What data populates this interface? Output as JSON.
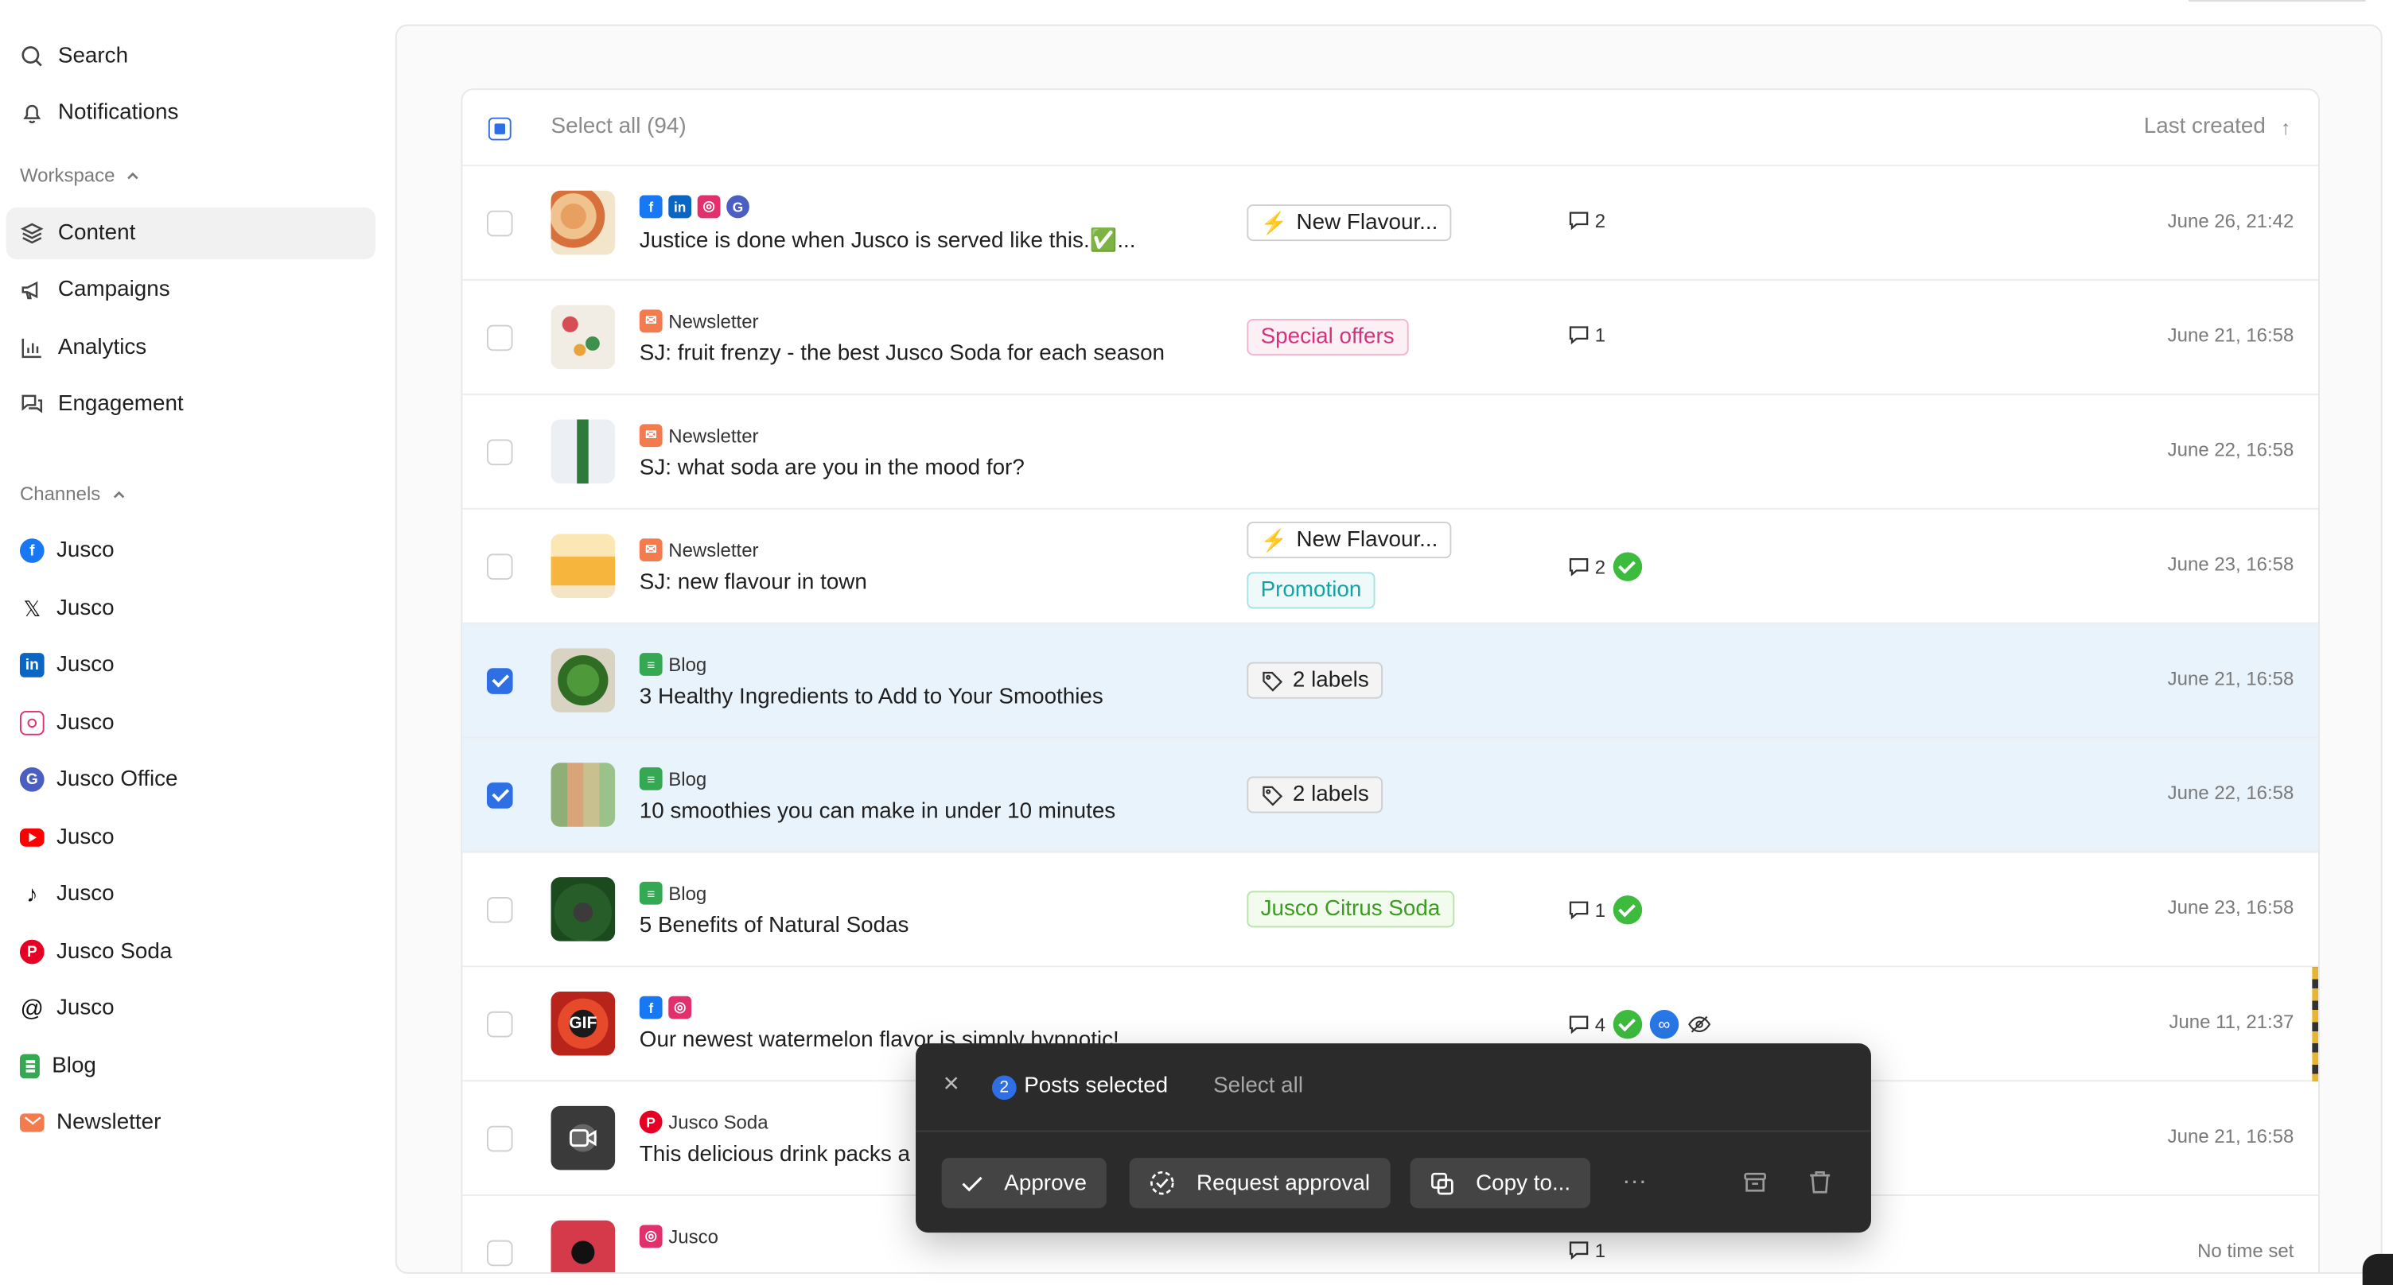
{
  "sidebar": {
    "search": "Search",
    "notifications": "Notifications",
    "workspace_heading": "Workspace",
    "workspace_items": [
      "Content",
      "Campaigns",
      "Analytics",
      "Engagement"
    ],
    "channels_heading": "Channels",
    "channels": [
      {
        "label": "Jusco",
        "icon": "facebook-icon",
        "color": "#1877f2"
      },
      {
        "label": "Jusco",
        "icon": "x-icon",
        "color": "#111111"
      },
      {
        "label": "Jusco",
        "icon": "linkedin-icon",
        "color": "#0a66c2"
      },
      {
        "label": "Jusco",
        "icon": "instagram-icon",
        "color": "#e1306c"
      },
      {
        "label": "Jusco Office",
        "icon": "google-business-icon",
        "color": "#4285f4"
      },
      {
        "label": "Jusco",
        "icon": "youtube-icon",
        "color": "#ff0000"
      },
      {
        "label": "Jusco",
        "icon": "tiktok-icon",
        "color": "#111111"
      },
      {
        "label": "Jusco Soda",
        "icon": "pinterest-icon",
        "color": "#e60023"
      },
      {
        "label": "Jusco",
        "icon": "threads-icon",
        "color": "#111111"
      },
      {
        "label": "Blog",
        "icon": "blog-icon",
        "color": "#34a853"
      },
      {
        "label": "Newsletter",
        "icon": "newsletter-icon",
        "color": "#f47b4d"
      }
    ]
  },
  "table": {
    "select_all": "Select all (94)",
    "sort_label": "Last created",
    "sort_arrow": "↑",
    "rows": [
      {
        "channel": "",
        "title": "Justice is done when Jusco is served like this.✅...",
        "tags": [
          "New Flavour..."
        ],
        "comments": "2",
        "date": "June 26, 21:42"
      },
      {
        "channel": "Newsletter",
        "title": "SJ: fruit frenzy - the best Jusco Soda for each season",
        "tags": [
          "Special offers"
        ],
        "comments": "1",
        "date": "June 21, 16:58"
      },
      {
        "channel": "Newsletter",
        "title": "SJ: what soda are you in the mood for?",
        "tags": [],
        "comments": "",
        "date": "June 22, 16:58"
      },
      {
        "channel": "Newsletter",
        "title": "SJ: new flavour in town",
        "tags": [
          "New Flavour...",
          "Promotion"
        ],
        "comments": "2",
        "date": "June 23, 16:58"
      },
      {
        "channel": "Blog",
        "title": "3 Healthy Ingredients to Add to Your Smoothies",
        "tags": [
          "2 labels"
        ],
        "comments": "",
        "date": "June 21, 16:58",
        "selected": true
      },
      {
        "channel": "Blog",
        "title": "10 smoothies you can make in under 10 minutes",
        "tags": [
          "2 labels"
        ],
        "comments": "",
        "date": "June 22, 16:58",
        "selected": true
      },
      {
        "channel": "Blog",
        "title": "5 Benefits of Natural Sodas",
        "tags": [
          "Jusco Citrus Soda"
        ],
        "comments": "1",
        "date": "June 23, 16:58"
      },
      {
        "channel": "",
        "title": "Our newest watermelon flavor is simply hypnotic!",
        "tags": [],
        "comments": "4",
        "date": "June 11, 21:37"
      },
      {
        "channel": "Jusco Soda",
        "title": "This delicious drink packs a",
        "tags": [],
        "comments": "",
        "date": "June 21, 16:58"
      },
      {
        "channel": "Jusco",
        "title": "",
        "tags": [],
        "comments": "1",
        "date": "No time set"
      }
    ]
  },
  "actionbar": {
    "count": "2",
    "selected_label": "Posts selected",
    "select_all": "Select all",
    "approve": "Approve",
    "request_approval": "Request approval",
    "copy_to": "Copy to...",
    "more": "···"
  },
  "thumb_gif_label": "GIF",
  "colors": {
    "accent": "#2f6fe4",
    "selected_row": "#e9f3fc",
    "action_bar": "#2b2b2b",
    "approved": "#3dbb3d"
  }
}
